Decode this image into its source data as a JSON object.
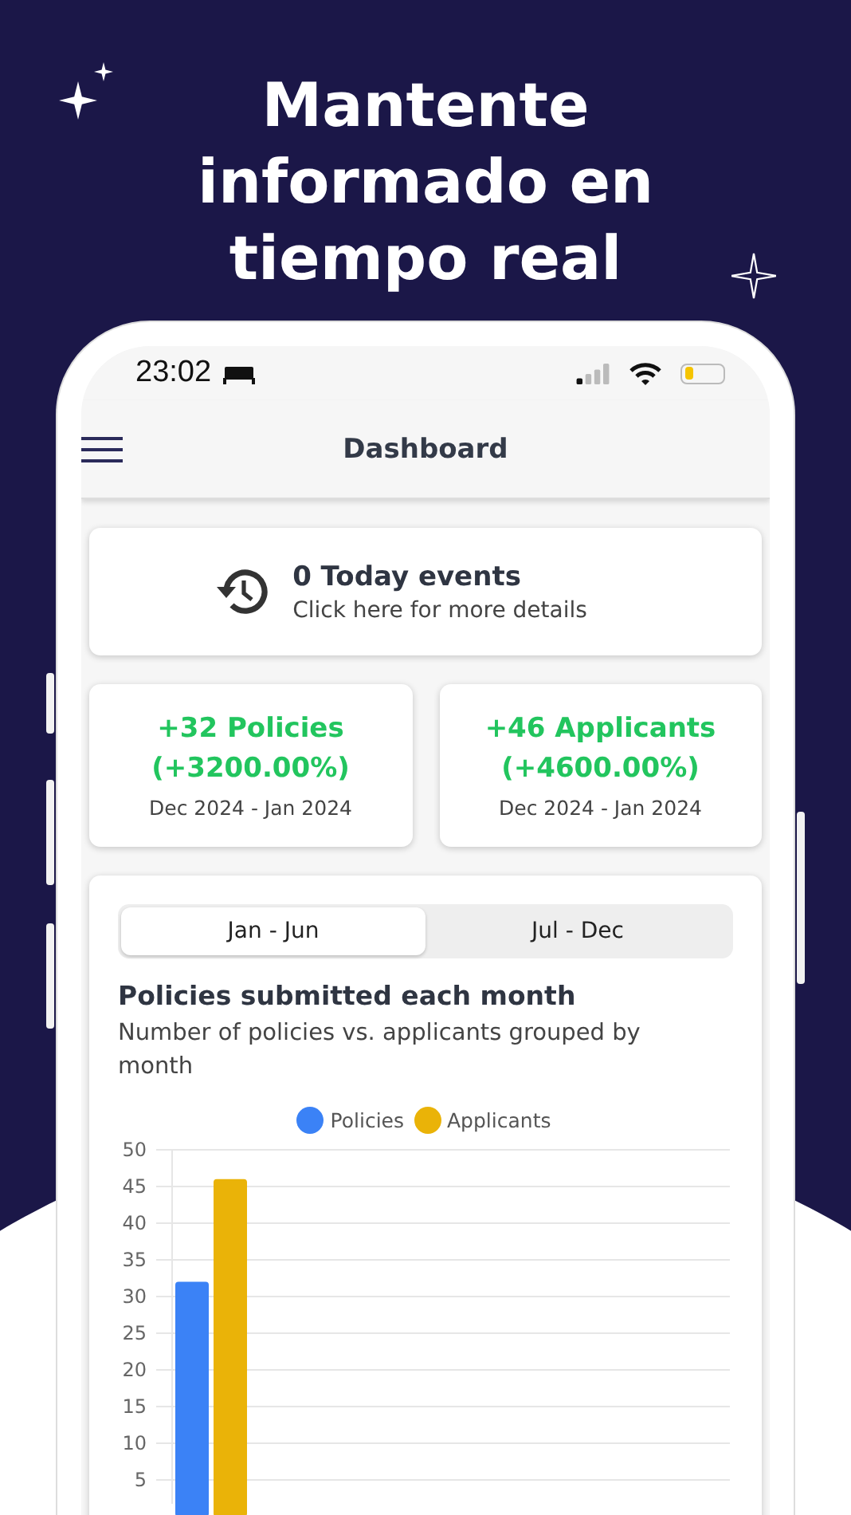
{
  "headline": "Mantente informado en tiempo real",
  "status_bar": {
    "time": "23:02"
  },
  "app_bar": {
    "title": "Dashboard"
  },
  "events_card": {
    "title": "0 Today events",
    "subtitle": "Click here for more details"
  },
  "stat_cards": [
    {
      "title": "+32 Policies",
      "change": "(+3200.00%)",
      "period": "Dec 2024 - Jan 2024"
    },
    {
      "title": "+46 Applicants",
      "change": "(+4600.00%)",
      "period": "Dec 2024 - Jan 2024"
    }
  ],
  "range_tabs": [
    {
      "label": "Jan - Jun",
      "selected": true
    },
    {
      "label": "Jul - Dec",
      "selected": false
    }
  ],
  "chart": {
    "title": "Policies submitted each month",
    "subtitle": "Number of policies vs. applicants grouped by month",
    "chart_data": {
      "type": "bar",
      "grid": true,
      "ylim": [
        0,
        50
      ],
      "yticks": [
        5,
        10,
        15,
        20,
        25,
        30,
        35,
        40,
        45,
        50
      ],
      "series": [
        {
          "name": "Policies",
          "color": "#3b82f6",
          "values": [
            32
          ]
        },
        {
          "name": "Applicants",
          "color": "#eab308",
          "values": [
            46
          ]
        }
      ]
    }
  }
}
